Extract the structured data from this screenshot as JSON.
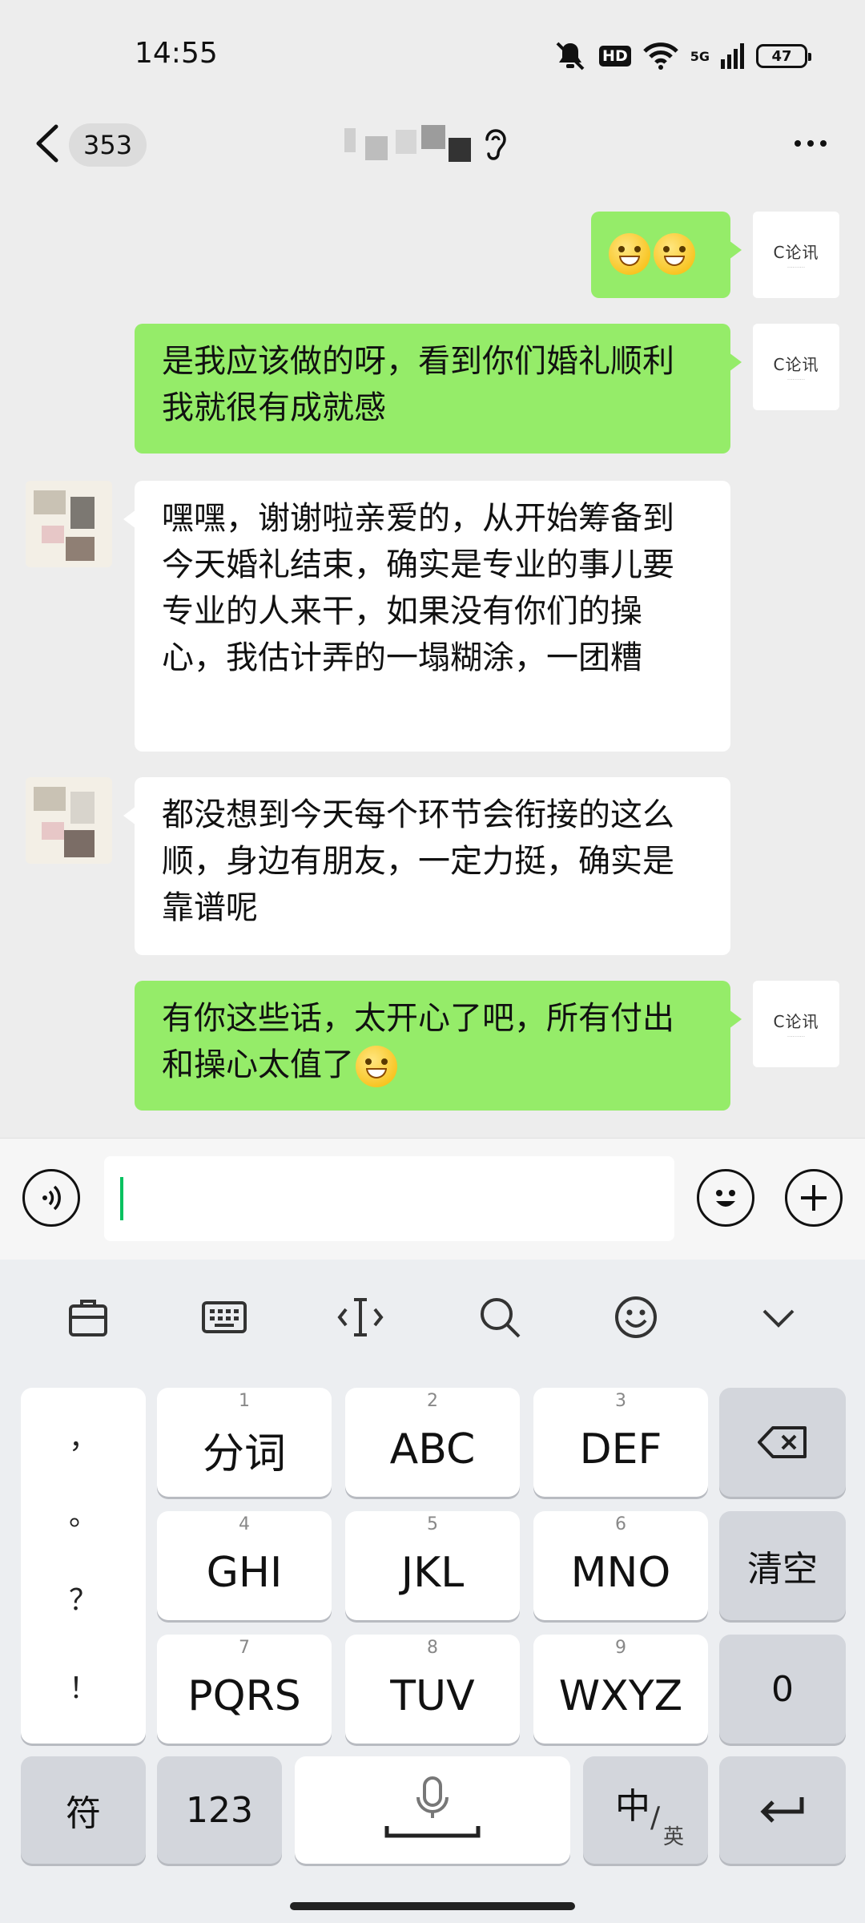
{
  "status_bar": {
    "time": "14:55",
    "network": "5G",
    "battery": "47"
  },
  "header": {
    "unread_count": "353"
  },
  "messages": [
    {
      "side": "mine",
      "text": ""
    },
    {
      "side": "mine",
      "text": "是我应该做的呀，看到你们婚礼顺利我就很有成就感"
    },
    {
      "side": "theirs",
      "text": "嘿嘿，谢谢啦亲爱的，从开始筹备到今天婚礼结束，确实是专业的事儿要专业的人来干，如果没有你们的操心，我估计弄的一塌糊涂，一团糟"
    },
    {
      "side": "theirs",
      "text": "都没想到今天每个环节会衔接的这么顺，身边有朋友，一定力挺，确实是靠谱呢"
    },
    {
      "side": "mine",
      "text": "有你这些话，太开心了吧，所有付出和操心太值了"
    }
  ],
  "avatar": {
    "logo_text": "C论讯"
  },
  "keyboard": {
    "punctuation": [
      "，",
      "。",
      "？",
      "！"
    ],
    "keys": [
      {
        "num": "1",
        "label": "分词"
      },
      {
        "num": "2",
        "label": "ABC"
      },
      {
        "num": "3",
        "label": "DEF"
      },
      {
        "num": "4",
        "label": "GHI"
      },
      {
        "num": "5",
        "label": "JKL"
      },
      {
        "num": "6",
        "label": "MNO"
      },
      {
        "num": "7",
        "label": "PQRS"
      },
      {
        "num": "8",
        "label": "TUV"
      },
      {
        "num": "9",
        "label": "WXYZ"
      }
    ],
    "clear": "清空",
    "zero": "0",
    "symbol": "符",
    "numeric": "123",
    "lang_main": "中",
    "lang_sub": "英"
  },
  "colors": {
    "sent_bubble": "#95ec69",
    "received_bubble": "#ffffff",
    "caret": "#07c160"
  },
  "icons": [
    "mute-icon",
    "wifi-icon",
    "signal-icon",
    "back-icon",
    "ear-icon",
    "more-icon",
    "voice-icon",
    "emoji-icon",
    "plus-icon",
    "clipboard-icon",
    "keyboard-icon",
    "cursor-icon",
    "search-icon",
    "smiley-icon",
    "chevron-down-icon",
    "backspace-icon",
    "mic-icon",
    "enter-icon"
  ]
}
